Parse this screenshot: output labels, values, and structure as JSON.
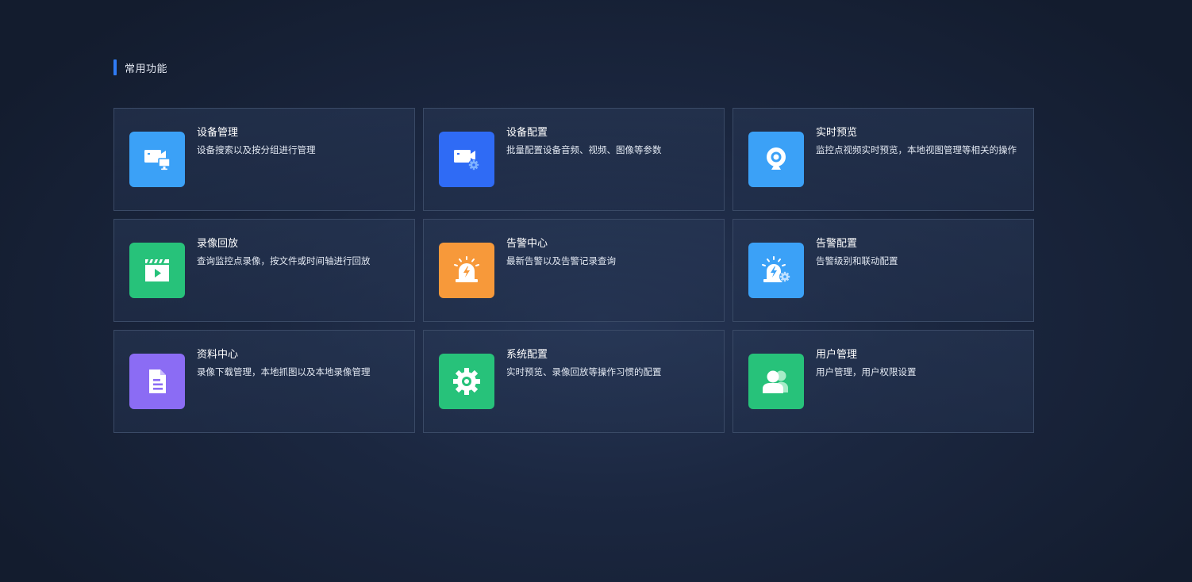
{
  "section": {
    "title": "常用功能",
    "accent_color": "#2f7bf5"
  },
  "cards": [
    {
      "title": "设备管理",
      "desc": "设备搜索以及按分组进行管理",
      "icon": "camera-monitor-icon",
      "color": "#3ba1f7"
    },
    {
      "title": "设备配置",
      "desc": "批量配置设备音频、视频、图像等参数",
      "icon": "camera-gear-icon",
      "color": "#2f6bf5"
    },
    {
      "title": "实时预览",
      "desc": "监控点视频实时预览，本地视图管理等相关的操作",
      "icon": "webcam-icon",
      "color": "#3ba1f7"
    },
    {
      "title": "录像回放",
      "desc": "查询监控点录像，按文件或时间轴进行回放",
      "icon": "clapperboard-play-icon",
      "color": "#27c27a"
    },
    {
      "title": "告警中心",
      "desc": "最新告警以及告警记录查询",
      "icon": "alarm-light-icon",
      "color": "#f7993a"
    },
    {
      "title": "告警配置",
      "desc": "告警级别和联动配置",
      "icon": "alarm-gear-icon",
      "color": "#3ba1f7"
    },
    {
      "title": "资料中心",
      "desc": "录像下载管理，本地抓图以及本地录像管理",
      "icon": "document-icon",
      "color": "#8b6cf4"
    },
    {
      "title": "系统配置",
      "desc": "实时预览、录像回放等操作习惯的配置",
      "icon": "gear-icon",
      "color": "#27c27a"
    },
    {
      "title": "用户管理",
      "desc": "用户管理，用户权限设置",
      "icon": "users-icon",
      "color": "#27c27a"
    }
  ]
}
